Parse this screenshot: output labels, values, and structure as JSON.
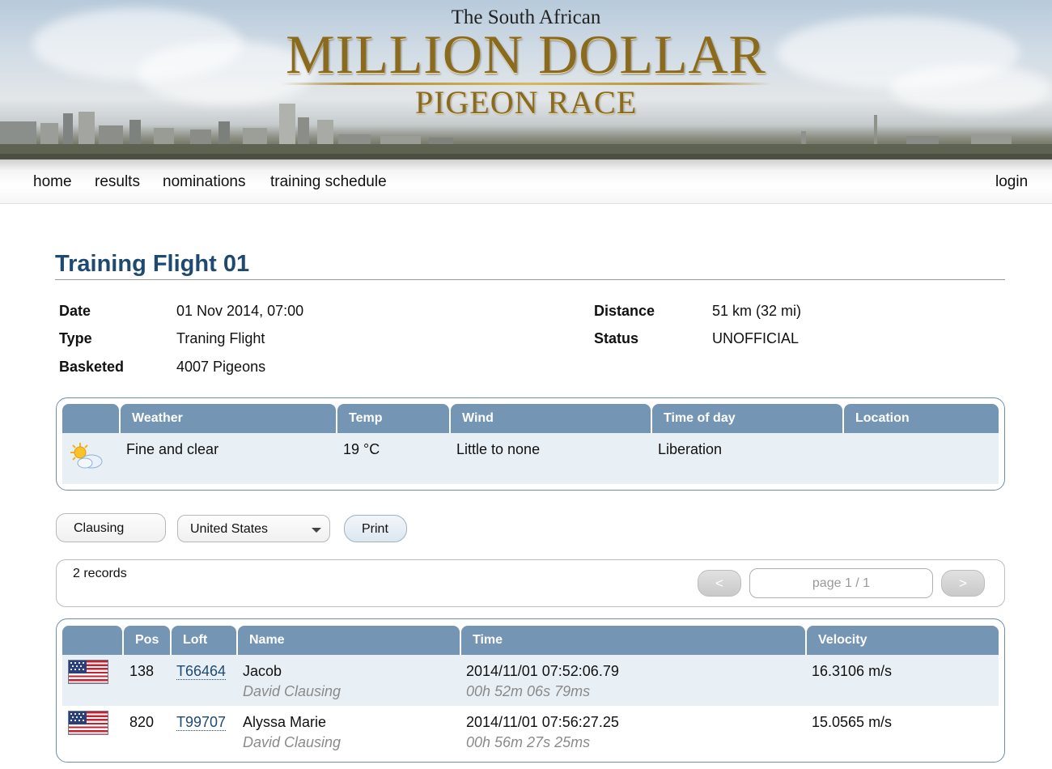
{
  "banner": {
    "line1": "The South African",
    "line2": "MILLION DOLLAR",
    "line3": "PIGEON RACE"
  },
  "nav": {
    "items": [
      "home",
      "results",
      "nominations",
      "training schedule"
    ],
    "login": "login"
  },
  "race": {
    "title": "Training Flight 01",
    "details_left": [
      {
        "label": "Date",
        "value": "01 Nov 2014, 07:00"
      },
      {
        "label": "Type",
        "value": "Traning Flight"
      },
      {
        "label": "Basketed",
        "value": "4007 Pigeons"
      }
    ],
    "details_right": [
      {
        "label": "Distance",
        "value": "51 km (32 mi)"
      },
      {
        "label": "Status",
        "value": "UNOFFICIAL"
      }
    ]
  },
  "weather": {
    "headers": [
      "Weather",
      "Temp",
      "Wind",
      "Time of day",
      "Location"
    ],
    "icon": "sun-cloud-icon",
    "row": {
      "weather": "Fine and clear",
      "temp": "19 °C",
      "wind": "Little to none",
      "time_of_day": "Liberation",
      "location": ""
    }
  },
  "filters": {
    "search_value": "Clausing",
    "country_selected": "United States",
    "print_label": "Print"
  },
  "pager": {
    "records": "2 records",
    "prev": "<",
    "next": ">",
    "page": "page 1 / 1"
  },
  "results": {
    "headers": [
      "Pos",
      "Loft",
      "Name",
      "Time",
      "Velocity"
    ],
    "rows": [
      {
        "flag": "us-flag-icon",
        "pos": "138",
        "loft": "T66464",
        "name": "Jacob",
        "owner": "David Clausing",
        "time": "2014/11/01 07:52:06.79",
        "duration": "00h 52m 06s 79ms",
        "velocity": "16.3106 m/s"
      },
      {
        "flag": "us-flag-icon",
        "pos": "820",
        "loft": "T99707",
        "name": "Alyssa Marie",
        "owner": "David Clausing",
        "time": "2014/11/01 07:56:27.25",
        "duration": "00h 56m 27s 25ms",
        "velocity": "15.0565 m/s"
      }
    ]
  },
  "colors": {
    "title": "#1e4a72",
    "table_header": "#7496b4",
    "row_shade": "#e9f0f5",
    "brand_gold": "#8a6a1e"
  }
}
